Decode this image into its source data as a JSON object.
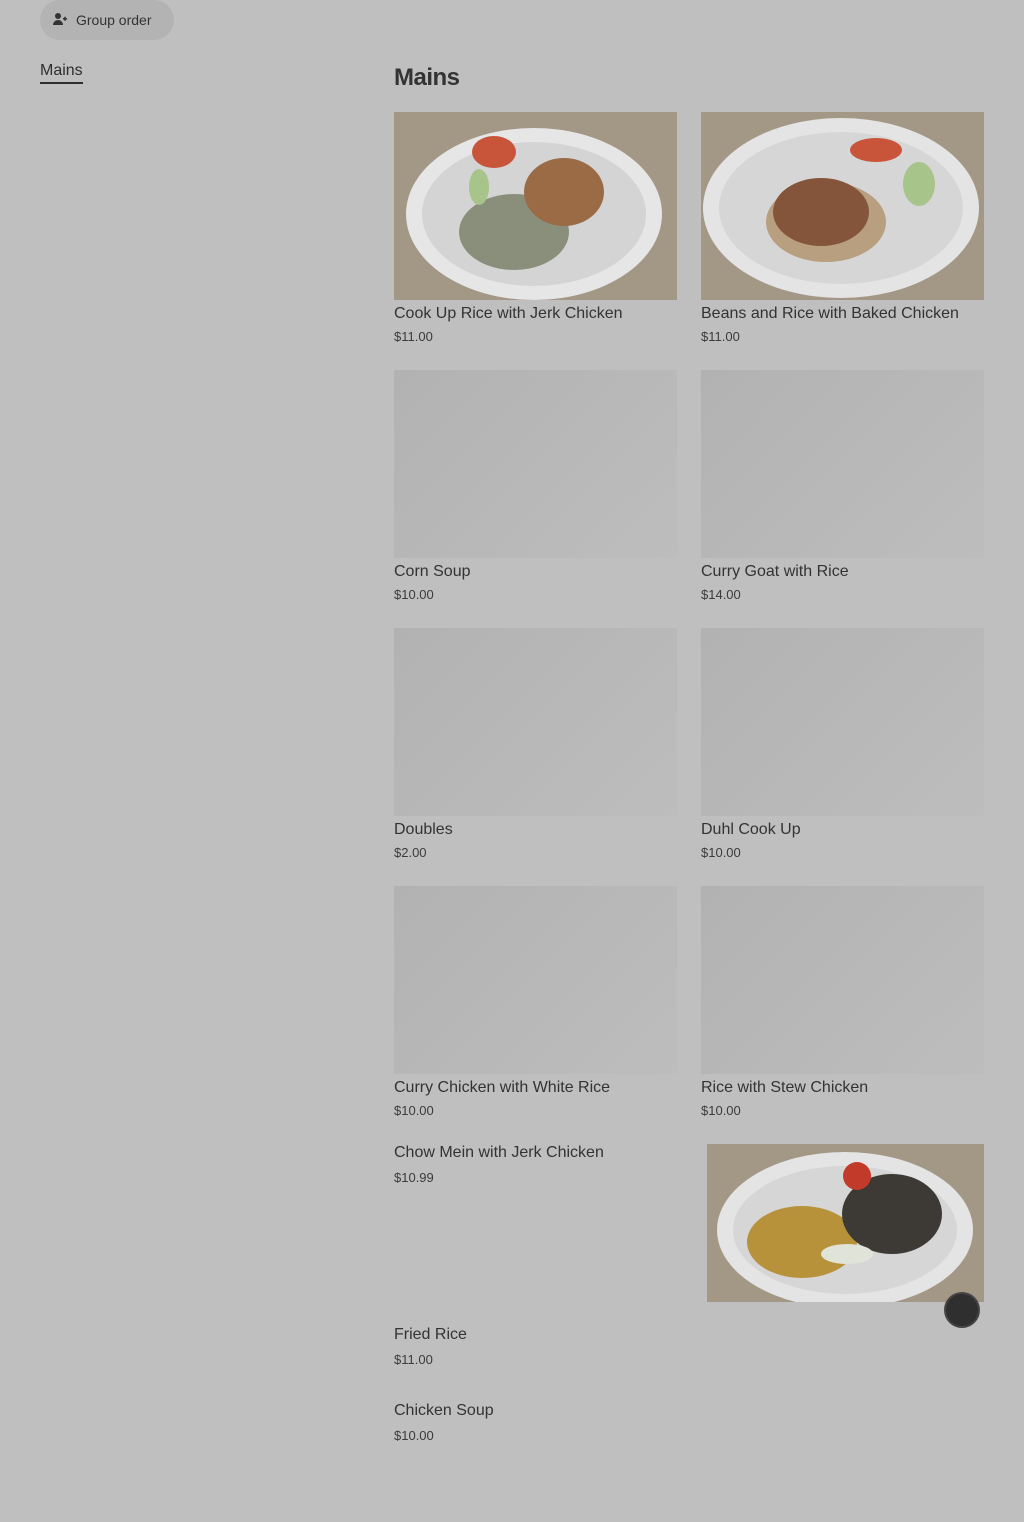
{
  "toolbar": {
    "group_order_label": "Group order",
    "group_order_icon": "person-add-icon"
  },
  "side_nav": {
    "items": [
      {
        "label": "Mains"
      }
    ]
  },
  "section": {
    "title": "Mains"
  },
  "menu_items": [
    {
      "name": "Cook Up Rice with Jerk Chicken",
      "price": "$11.00"
    },
    {
      "name": "Beans and Rice with Baked Chicken",
      "price": "$11.00"
    },
    {
      "name": "Corn Soup",
      "price": "$10.00"
    },
    {
      "name": "Curry Goat with Rice",
      "price": "$14.00"
    },
    {
      "name": "Doubles",
      "price": "$2.00"
    },
    {
      "name": "Duhl Cook Up",
      "price": "$10.00"
    },
    {
      "name": "Curry Chicken with White Rice",
      "price": "$10.00"
    },
    {
      "name": "Rice with Stew Chicken",
      "price": "$10.00"
    }
  ],
  "list_items": [
    {
      "name": "Chow Mein with Jerk Chicken",
      "price": "$10.99"
    },
    {
      "name": "Fried Rice",
      "price": "$11.00"
    },
    {
      "name": "Chicken Soup",
      "price": "$10.00"
    }
  ],
  "colors": {
    "background": "#bfbfbf",
    "placeholder": "#b5b5b5",
    "text": "#333333"
  }
}
